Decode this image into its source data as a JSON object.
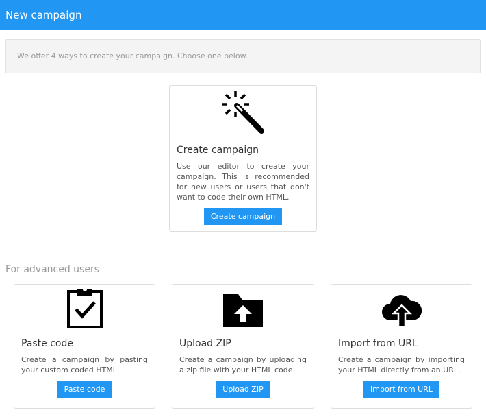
{
  "header": {
    "title": "New campaign"
  },
  "info": {
    "text": "We offer 4 ways to create your campaign. Choose one below."
  },
  "main_card": {
    "icon": "magic-wand-icon",
    "title": "Create campaign",
    "description": "Use our editor to create your campaign. This is recommended for new users or users that don't want to code their own HTML.",
    "button": "Create campaign"
  },
  "advanced": {
    "heading": "For advanced users",
    "cards": [
      {
        "icon": "clipboard-check-icon",
        "title": "Paste code",
        "description": "Create a campaign by pasting your custom coded HTML.",
        "button": "Paste code"
      },
      {
        "icon": "folder-upload-icon",
        "title": "Upload ZIP",
        "description": "Create a campaign by uploading a zip file with your HTML code.",
        "button": "Upload ZIP"
      },
      {
        "icon": "cloud-upload-icon",
        "title": "Import from URL",
        "description": "Create a campaign by importing your HTML directly from an URL.",
        "button": "Import from URL"
      }
    ]
  },
  "colors": {
    "accent": "#2196f3"
  }
}
